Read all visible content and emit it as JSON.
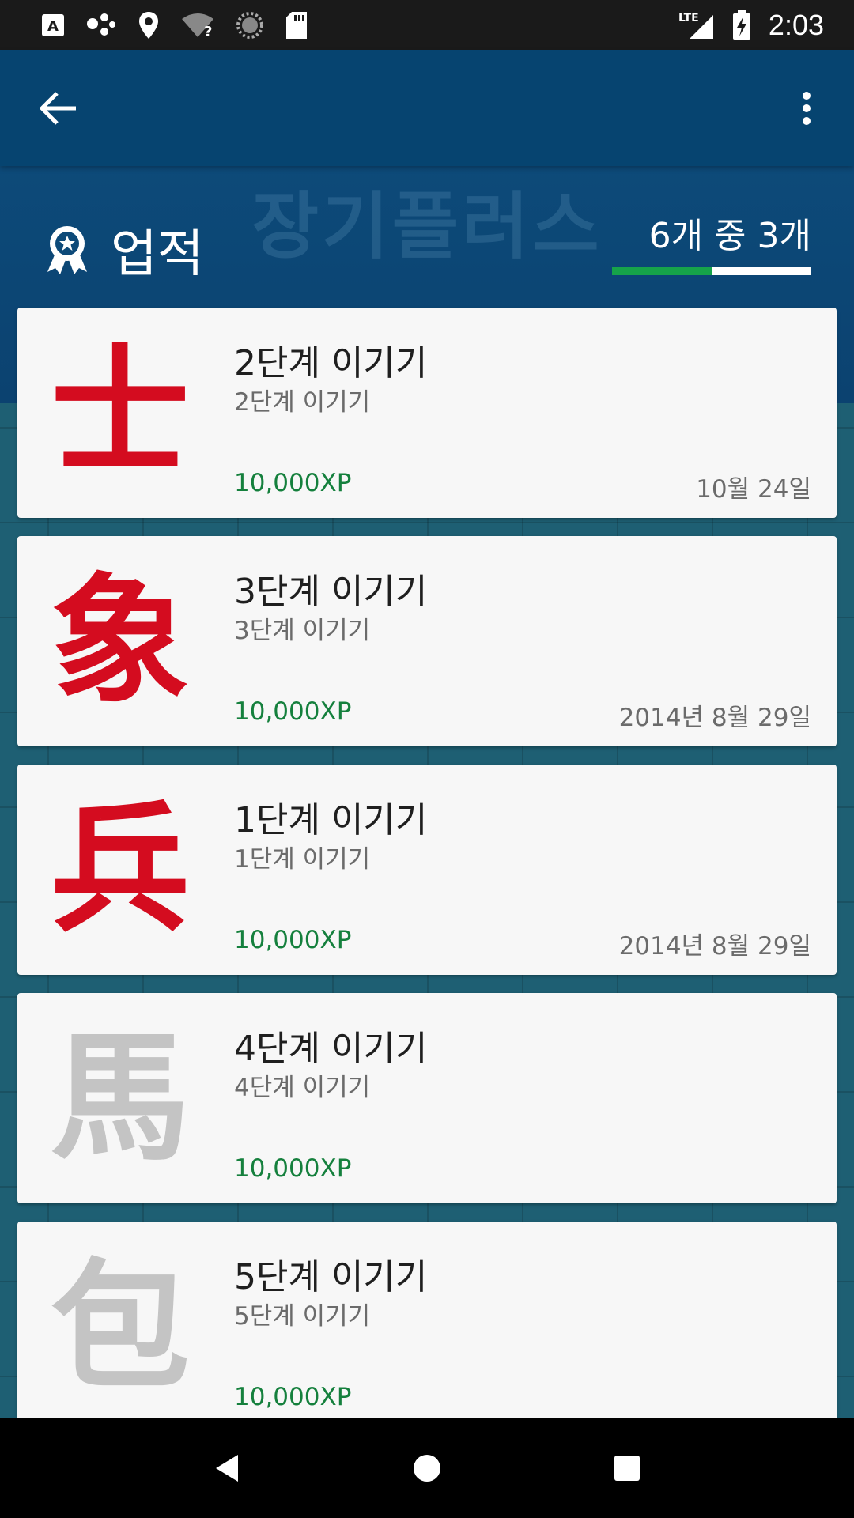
{
  "status_bar": {
    "time": "2:03",
    "network_label": "LTE",
    "icons": [
      "a-keyboard-icon",
      "dots-icon",
      "location-icon",
      "wifi-unknown-icon",
      "loading-icon",
      "sd-card-icon",
      "signal-icon",
      "battery-charging-icon"
    ]
  },
  "app_bar": {
    "back_icon": "arrow-back-icon",
    "menu_icon": "more-vert-icon"
  },
  "header": {
    "watermark": "장기플러스",
    "title": "업적",
    "progress_text": "6개 중 3개",
    "progress_fraction": 0.5,
    "colors": {
      "progress_fill": "#16a34a",
      "progress_track": "#ffffff"
    }
  },
  "achievements": [
    {
      "glyph": "士",
      "title": "2단계 이기기",
      "subtitle": "2단계 이기기",
      "xp": "10,000XP",
      "date": "10월 24일",
      "unlocked": true
    },
    {
      "glyph": "象",
      "title": "3단계 이기기",
      "subtitle": "3단계 이기기",
      "xp": "10,000XP",
      "date": "2014년 8월 29일",
      "unlocked": true
    },
    {
      "glyph": "兵",
      "title": "1단계 이기기",
      "subtitle": "1단계 이기기",
      "xp": "10,000XP",
      "date": "2014년 8월 29일",
      "unlocked": true
    },
    {
      "glyph": "馬",
      "title": "4단계 이기기",
      "subtitle": "4단계 이기기",
      "xp": "10,000XP",
      "date": "",
      "unlocked": false
    },
    {
      "glyph": "包",
      "title": "5단계 이기기",
      "subtitle": "5단계 이기기",
      "xp": "10,000XP",
      "date": "",
      "unlocked": false
    }
  ],
  "colors": {
    "unlocked_glyph": "#d40c1f",
    "locked_glyph": "#c4c4c4",
    "xp": "#15803d"
  },
  "nav_bar": {
    "back": "nav-back-icon",
    "home": "nav-home-icon",
    "recents": "nav-recents-icon"
  }
}
